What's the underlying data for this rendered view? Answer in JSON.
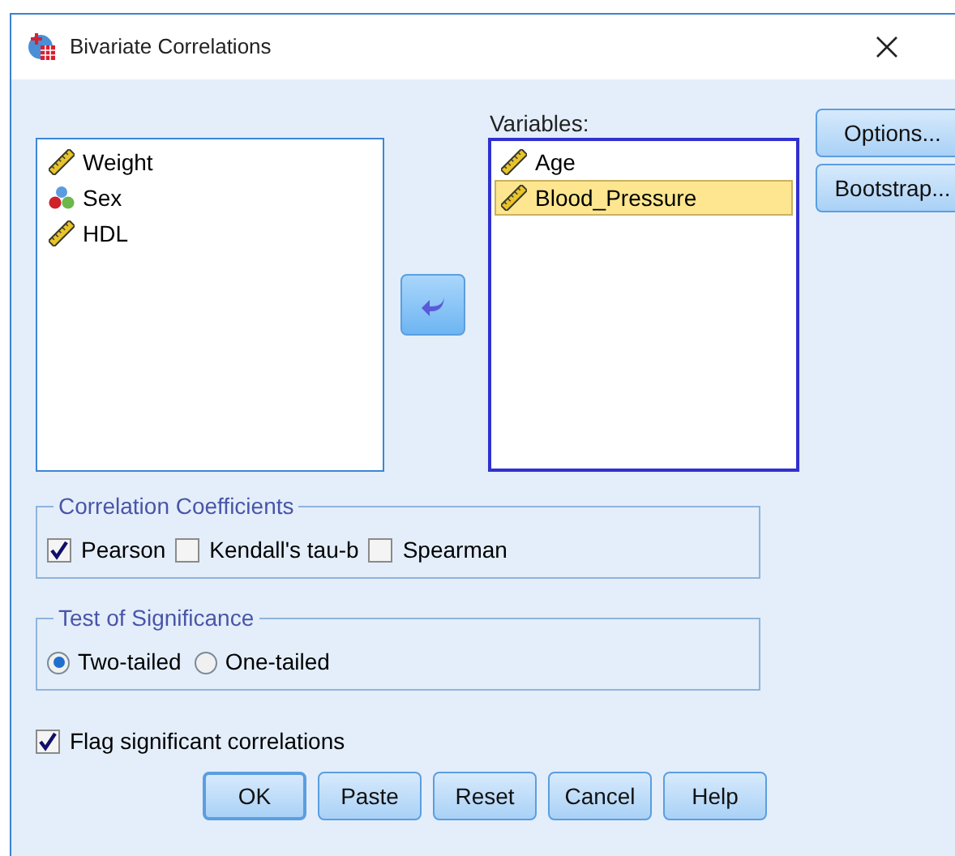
{
  "window": {
    "title": "Bivariate Correlations"
  },
  "source_list": {
    "items": [
      {
        "label": "Weight",
        "kind": "scale",
        "selected": false
      },
      {
        "label": "Sex",
        "kind": "nominal",
        "selected": false
      },
      {
        "label": "HDL",
        "kind": "scale",
        "selected": false
      }
    ]
  },
  "variables": {
    "label": "Variables:",
    "items": [
      {
        "label": "Age",
        "kind": "scale",
        "selected": false
      },
      {
        "label": "Blood_Pressure",
        "kind": "scale",
        "selected": true
      }
    ]
  },
  "side_buttons": [
    "Options...",
    "Bootstrap..."
  ],
  "correlation_coefficients": {
    "title": "Correlation Coefficients",
    "options": [
      {
        "label": "Pearson",
        "checked": true
      },
      {
        "label": "Kendall's tau-b",
        "checked": false
      },
      {
        "label": "Spearman",
        "checked": false
      }
    ]
  },
  "test_of_significance": {
    "title": "Test of Significance",
    "options": [
      {
        "label": "Two-tailed",
        "selected": true
      },
      {
        "label": "One-tailed",
        "selected": false
      }
    ]
  },
  "flag_significant": {
    "label": "Flag significant correlations",
    "checked": true
  },
  "buttons": [
    {
      "label": "OK",
      "default": true
    },
    {
      "label": "Paste",
      "default": false
    },
    {
      "label": "Reset",
      "default": false
    },
    {
      "label": "Cancel",
      "default": false
    },
    {
      "label": "Help",
      "default": false
    }
  ]
}
